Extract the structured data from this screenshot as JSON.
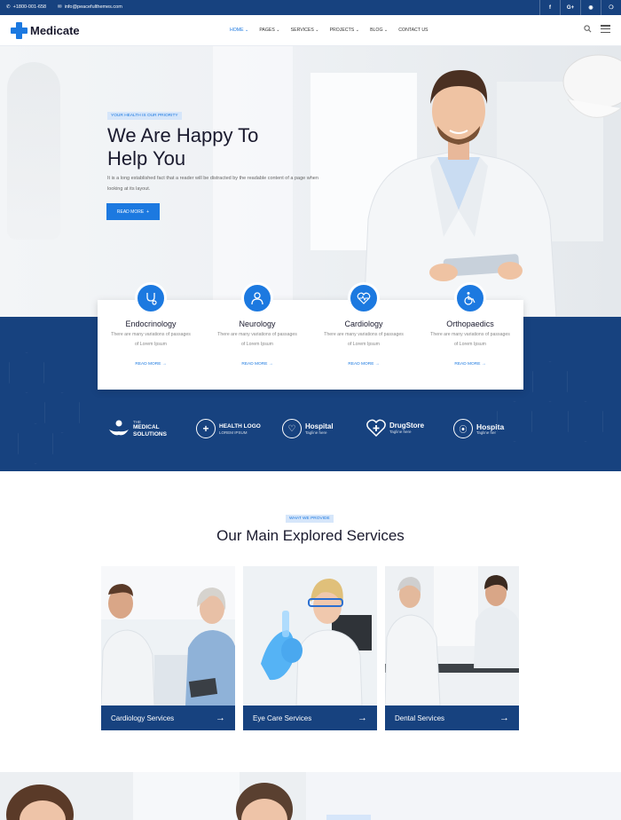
{
  "topbar": {
    "phone": "+1800-001-658",
    "email": "info@peacefulthemes.com",
    "social": [
      "f",
      "G+",
      "ig",
      "p"
    ]
  },
  "header": {
    "logo": "Medicate",
    "nav": [
      {
        "label": "HOME",
        "dropdown": true,
        "active": true
      },
      {
        "label": "PAGES",
        "dropdown": true
      },
      {
        "label": "SERVICES",
        "dropdown": true
      },
      {
        "label": "PROJECTS",
        "dropdown": true
      },
      {
        "label": "BLOG",
        "dropdown": true
      },
      {
        "label": "CONTACT US",
        "dropdown": false
      }
    ]
  },
  "hero": {
    "badge": "YOUR HEALTH IS OUR PRIORITY",
    "title_line1": "We Are Happy To",
    "title_line2": "Help You",
    "description": "It is a long established fact that a reader will be distracted by the readable content of a page when looking at its layout.",
    "button": "READ MORE"
  },
  "features": [
    {
      "title": "Endocrinology",
      "text": "There are many variations of passages of Lorem Ipsum",
      "link": "READ MORE",
      "icon": "stethoscope-icon"
    },
    {
      "title": "Neurology",
      "text": "There are many variations of passages of Lorem Ipsum",
      "link": "READ MORE",
      "icon": "doctor-icon"
    },
    {
      "title": "Cardiology",
      "text": "There are many variations of passages of Lorem Ipsum",
      "link": "READ MORE",
      "icon": "heartbeat-icon"
    },
    {
      "title": "Orthopaedics",
      "text": "There are many variations of passages of Lorem Ipsum",
      "link": "READ MORE",
      "icon": "wheelchair-icon"
    }
  ],
  "partners": [
    {
      "name": "MEDICAL SOLUTIONS",
      "prefix": "THE",
      "sub": ""
    },
    {
      "name": "HEALTH LOGO",
      "prefix": "",
      "sub": "LOREM IPSUM"
    },
    {
      "name": "Hospital",
      "prefix": "",
      "sub": "Tagline here"
    },
    {
      "name": "DrugStore",
      "prefix": "",
      "sub": "Tagline here"
    },
    {
      "name": "Hospita",
      "prefix": "",
      "sub": "Tagline her"
    }
  ],
  "services": {
    "badge": "WHAT WE PROVIDE",
    "title": "Our Main Explored Services",
    "cards": [
      {
        "label": "Cardiology Services"
      },
      {
        "label": "Eye Care Services"
      },
      {
        "label": "Dental Services"
      }
    ]
  },
  "colors": {
    "primary": "#1c79e0",
    "navy": "#17427f"
  }
}
